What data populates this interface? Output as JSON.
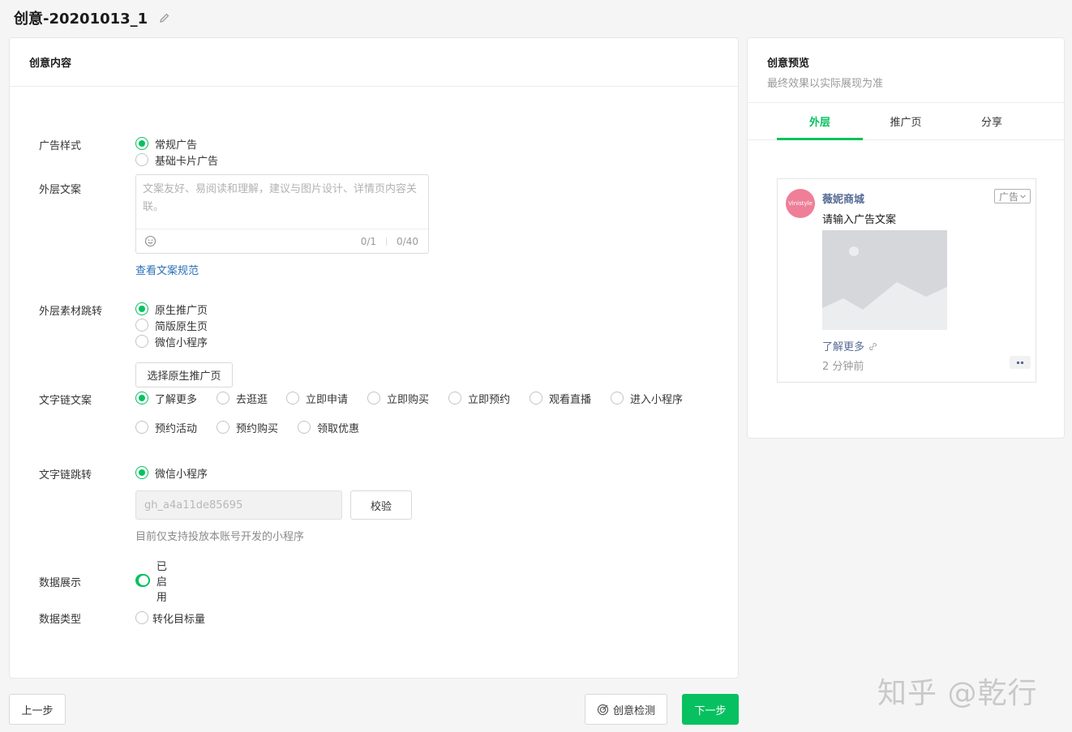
{
  "page": {
    "title": "创意-20201013_1"
  },
  "main": {
    "card_title": "创意内容",
    "ad_style": {
      "label": "广告样式",
      "options": [
        {
          "label": "常规广告",
          "checked": true
        },
        {
          "label": "基础卡片广告",
          "checked": false
        }
      ]
    },
    "outer_copy": {
      "label": "外层文案",
      "placeholder": "文案友好、易阅读和理解，建议与图片设计、详情页内容关联。",
      "count_a": "0/1",
      "count_b": "0/40",
      "link": "查看文案规范"
    },
    "outer_jump": {
      "label": "外层素材跳转",
      "options": [
        {
          "label": "原生推广页",
          "checked": true
        },
        {
          "label": "简版原生页",
          "checked": false
        },
        {
          "label": "微信小程序",
          "checked": false
        }
      ],
      "button": "选择原生推广页"
    },
    "link_copy": {
      "label": "文字链文案",
      "options": [
        {
          "label": "了解更多",
          "checked": true
        },
        {
          "label": "去逛逛",
          "checked": false
        },
        {
          "label": "立即申请",
          "checked": false
        },
        {
          "label": "立即购买",
          "checked": false
        },
        {
          "label": "立即预约",
          "checked": false
        },
        {
          "label": "观看直播",
          "checked": false
        },
        {
          "label": "进入小程序",
          "checked": false
        },
        {
          "label": "预约活动",
          "checked": false
        },
        {
          "label": "预约购买",
          "checked": false
        },
        {
          "label": "领取优惠",
          "checked": false
        }
      ]
    },
    "link_jump": {
      "label": "文字链跳转",
      "option": "微信小程序",
      "input_value": "gh_a4a11de85695",
      "verify_button": "校验",
      "hint": "目前仅支持投放本账号开发的小程序"
    },
    "data_display": {
      "label": "数据展示",
      "status": "已启用",
      "enabled": true
    },
    "data_type": {
      "label": "数据类型",
      "option": "转化目标量"
    }
  },
  "footer": {
    "prev": "上一步",
    "check": "创意检测",
    "next": "下一步"
  },
  "preview": {
    "title": "创意预览",
    "subtitle": "最终效果以实际展现为准",
    "tabs": [
      {
        "label": "外层",
        "active": true
      },
      {
        "label": "推广页",
        "active": false
      },
      {
        "label": "分享",
        "active": false
      }
    ],
    "ad": {
      "avatar_text": "Vinistyle",
      "name": "薇妮商城",
      "tag": "广告",
      "text": "请输入广告文案",
      "more": "了解更多",
      "time": "2 分钟前"
    }
  },
  "watermark": "知乎 @乾行",
  "colors": {
    "accent": "#07c160",
    "link": "#2c6fb7",
    "ad_name": "#576b95"
  }
}
